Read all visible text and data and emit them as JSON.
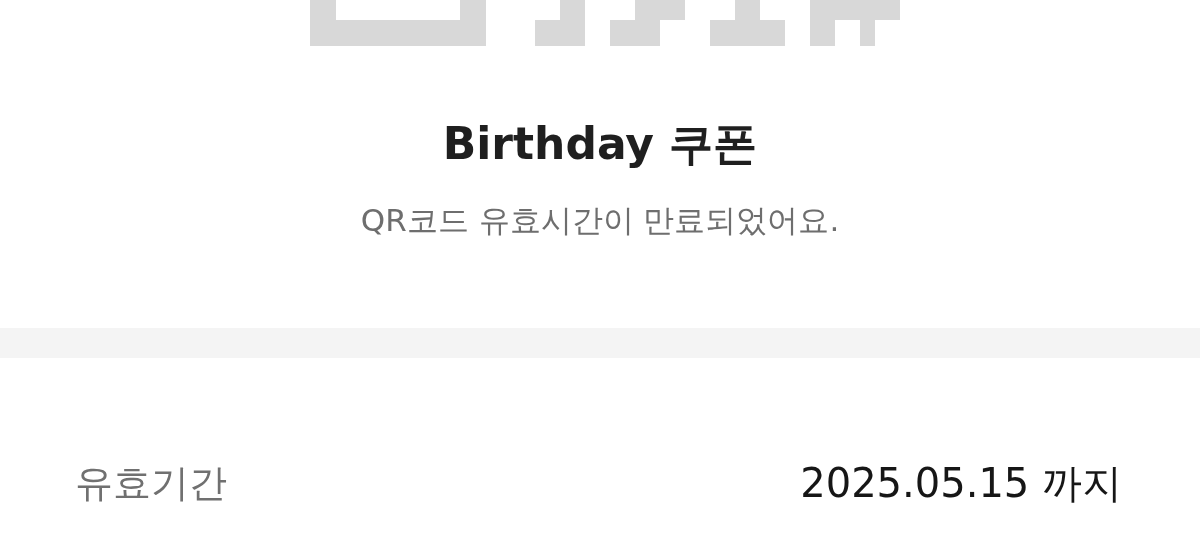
{
  "coupon": {
    "title": "Birthday 쿠폰",
    "message": "QR코드 유효시간이 만료되었어요."
  },
  "details": [
    {
      "label": "유효기간",
      "value": "2025.05.15 까지"
    }
  ]
}
